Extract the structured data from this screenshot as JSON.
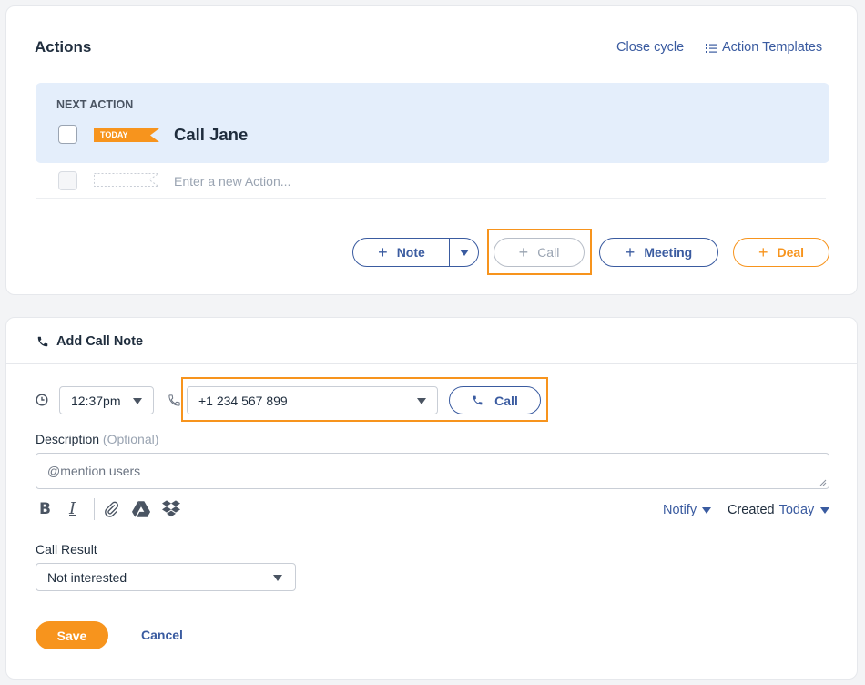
{
  "actions": {
    "title": "Actions",
    "close_cycle": "Close cycle",
    "action_templates": "Action Templates",
    "next_action_label": "NEXT ACTION",
    "today_badge": "TODAY",
    "next_action_title": "Call Jane",
    "new_action_placeholder": "Enter a new Action...",
    "buttons": {
      "note": "Note",
      "call": "Call",
      "meeting": "Meeting",
      "deal": "Deal"
    }
  },
  "call_note": {
    "title": "Add Call Note",
    "time": "12:37pm",
    "phone": "+1 234 567 899",
    "call_button": "Call",
    "description_label": "Description",
    "description_optional": "(Optional)",
    "description_placeholder": "@mention users",
    "notify": "Notify",
    "created_label": "Created",
    "created_value": "Today",
    "call_result_label": "Call Result",
    "call_result_value": "Not interested",
    "save": "Save",
    "cancel": "Cancel"
  },
  "colors": {
    "accent_orange": "#f7941d",
    "link_blue": "#3a5ba0",
    "next_action_bg": "#e4eefb"
  }
}
